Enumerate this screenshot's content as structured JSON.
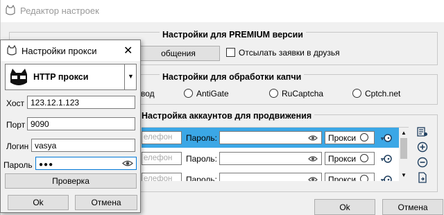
{
  "main": {
    "title": "Редактор настроек",
    "premium": {
      "title": "Настройки для PREMIUM версии",
      "button_label": "общения",
      "friends_label": "Отсылать заявки в друзья"
    },
    "captcha": {
      "title": "Настройки для обработки капчи",
      "option_manual": "вод",
      "options": [
        "AntiGate",
        "RuCaptcha",
        "Cptch.net"
      ]
    },
    "accounts": {
      "title": "Настройка аккаунтов для продвижения",
      "phone_placeholder": "елефон",
      "password_label": "Пароль:",
      "proxy_label": "Прокси",
      "rows": 3
    },
    "ok_label": "Ok",
    "cancel_label": "Отмена"
  },
  "proxy_dialog": {
    "title": "Настройки прокси",
    "proxy_type": "HTTP прокси",
    "host_label": "Хост",
    "host_value": "123.12.1.123",
    "port_label": "Порт",
    "port_value": "9090",
    "login_label": "Логин",
    "login_value": "vasya",
    "password_label": "Пароль",
    "password_value": "●●●",
    "check_label": "Проверка",
    "ok_label": "Ok",
    "cancel_label": "Отмена"
  },
  "colors": {
    "highlight_row": "#3ba7e6",
    "accent_dark": "#1f3f5f"
  }
}
